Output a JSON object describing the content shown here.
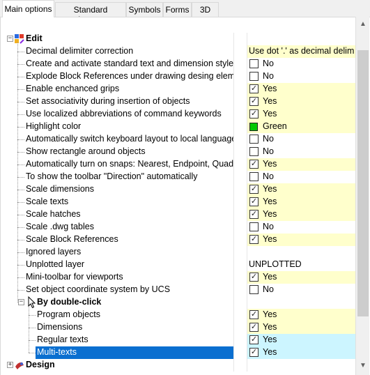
{
  "tabs": [
    {
      "label": "Main options",
      "active": true
    },
    {
      "label": "Standard elements",
      "active": false
    },
    {
      "label": "Symbols",
      "active": false
    },
    {
      "label": "Forms",
      "active": false
    },
    {
      "label": "3D",
      "active": false
    }
  ],
  "tree": {
    "edit": {
      "label": "Edit",
      "expander": "−"
    },
    "items": [
      {
        "label": "Decimal delimiter correction",
        "value": "Use dot '.' as decimal delim",
        "kind": "text",
        "bg": "yellow"
      },
      {
        "label": "Create and activate standard text and dimension styles",
        "value": "No",
        "kind": "checkbox",
        "checked": false,
        "bg": "white"
      },
      {
        "label": "Explode Block References under drawing desing element",
        "value": "No",
        "kind": "checkbox",
        "checked": false,
        "bg": "white"
      },
      {
        "label": "Enable enchanced grips",
        "value": "Yes",
        "kind": "checkbox",
        "checked": true,
        "bg": "yellow"
      },
      {
        "label": "Set associativity during insertion of objects",
        "value": "Yes",
        "kind": "checkbox",
        "checked": true,
        "bg": "yellow"
      },
      {
        "label": "Use localized abbreviations of command keywords",
        "value": "Yes",
        "kind": "checkbox",
        "checked": true,
        "bg": "yellow"
      },
      {
        "label": "Highlight color",
        "value": "Green",
        "kind": "color",
        "swatch": "#00c800",
        "bg": "yellow"
      },
      {
        "label": "Automatically switch keyboard layout to local language",
        "value": "No",
        "kind": "checkbox",
        "checked": false,
        "bg": "white"
      },
      {
        "label": "Show rectangle around objects",
        "value": "No",
        "kind": "checkbox",
        "checked": false,
        "bg": "white"
      },
      {
        "label": "Automatically turn on snaps: Nearest, Endpoint, Quadrant",
        "value": "Yes",
        "kind": "checkbox",
        "checked": true,
        "bg": "yellow"
      },
      {
        "label": "To show the toolbar \"Direction\" automatically",
        "value": "No",
        "kind": "checkbox",
        "checked": false,
        "bg": "white"
      },
      {
        "label": "Scale dimensions",
        "value": "Yes",
        "kind": "checkbox",
        "checked": true,
        "bg": "yellow"
      },
      {
        "label": "Scale texts",
        "value": "Yes",
        "kind": "checkbox",
        "checked": true,
        "bg": "yellow"
      },
      {
        "label": "Scale hatches",
        "value": "Yes",
        "kind": "checkbox",
        "checked": true,
        "bg": "yellow"
      },
      {
        "label": "Scale .dwg tables",
        "value": "No",
        "kind": "checkbox",
        "checked": false,
        "bg": "white"
      },
      {
        "label": "Scale Block References",
        "value": "Yes",
        "kind": "checkbox",
        "checked": true,
        "bg": "yellow"
      },
      {
        "label": "Ignored layers",
        "value": "",
        "kind": "text",
        "bg": "white"
      },
      {
        "label": "Unplotted layer",
        "value": "UNPLOTTED",
        "kind": "text",
        "bg": "white"
      },
      {
        "label": "Mini-toolbar for viewports",
        "value": "Yes",
        "kind": "checkbox",
        "checked": true,
        "bg": "yellow"
      },
      {
        "label": "Set object coordinate system by UCS",
        "value": "No",
        "kind": "checkbox",
        "checked": false,
        "bg": "white"
      }
    ],
    "double_click": {
      "label": "By double-click",
      "expander": "−",
      "items": [
        {
          "label": "Program objects",
          "value": "Yes",
          "kind": "checkbox",
          "checked": true,
          "bg": "yellow"
        },
        {
          "label": "Dimensions",
          "value": "Yes",
          "kind": "checkbox",
          "checked": true,
          "bg": "yellow"
        },
        {
          "label": "Regular texts",
          "value": "Yes",
          "kind": "checkbox",
          "checked": true,
          "bg": "cyan"
        },
        {
          "label": "Multi-texts",
          "value": "Yes",
          "kind": "checkbox",
          "checked": true,
          "bg": "cyan",
          "selected": true
        }
      ]
    },
    "design": {
      "label": "Design",
      "expander": "+"
    }
  },
  "scrollbar": {
    "up_icon": "arrow-up-icon",
    "down_icon": "arrow-down-icon"
  }
}
